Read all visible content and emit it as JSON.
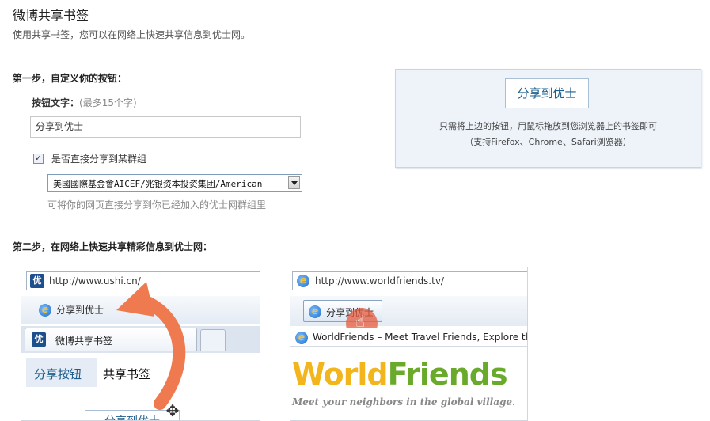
{
  "page": {
    "title": "微博共享书签",
    "description": "使用共享书签，您可以在网络上快速共享信息到优士网。"
  },
  "step1": {
    "title": "第一步，自定义你的按钮：",
    "button_text_label": "按钮文字：",
    "button_text_hint": "(最多15个字)",
    "button_text_value": "分享到优士",
    "checkbox_checked": true,
    "checkbox_label": "是否直接分享到某群组",
    "group_select_value": "美國國際基金會AICEF/兆银资本投资集团/American",
    "group_hint": "可将你的网页直接分享到你已经加入的优士网群组里"
  },
  "preview": {
    "button_label": "分享到优士",
    "note_line1": "只需将上边的按钮，用鼠标拖放到您浏览器上的书签即可",
    "note_line2": "（支持Firefox、Chrome、Safari浏览器）"
  },
  "step2": {
    "title": "第二步，在网络上快速共享精彩信息到优士网："
  },
  "screenshot1": {
    "url": "http://www.ushi.cn/",
    "favicon_text": "优",
    "bookmark_label": "分享到优士",
    "tab_label": "微博共享书签",
    "subtab_a": "分享按钮",
    "subtab_b": "共享书签",
    "drag_button_label": "分享到优士",
    "arrow_color": "#f07a50"
  },
  "screenshot2": {
    "url": "http://www.worldfriends.tv/",
    "bookmark_label": "分享到优士",
    "tab_label": "WorldFriends – Meet Travel Friends, Explore the",
    "logo_part1": "World",
    "logo_part2": "Friends",
    "tagline": "Meet your neighbors in the global village."
  }
}
